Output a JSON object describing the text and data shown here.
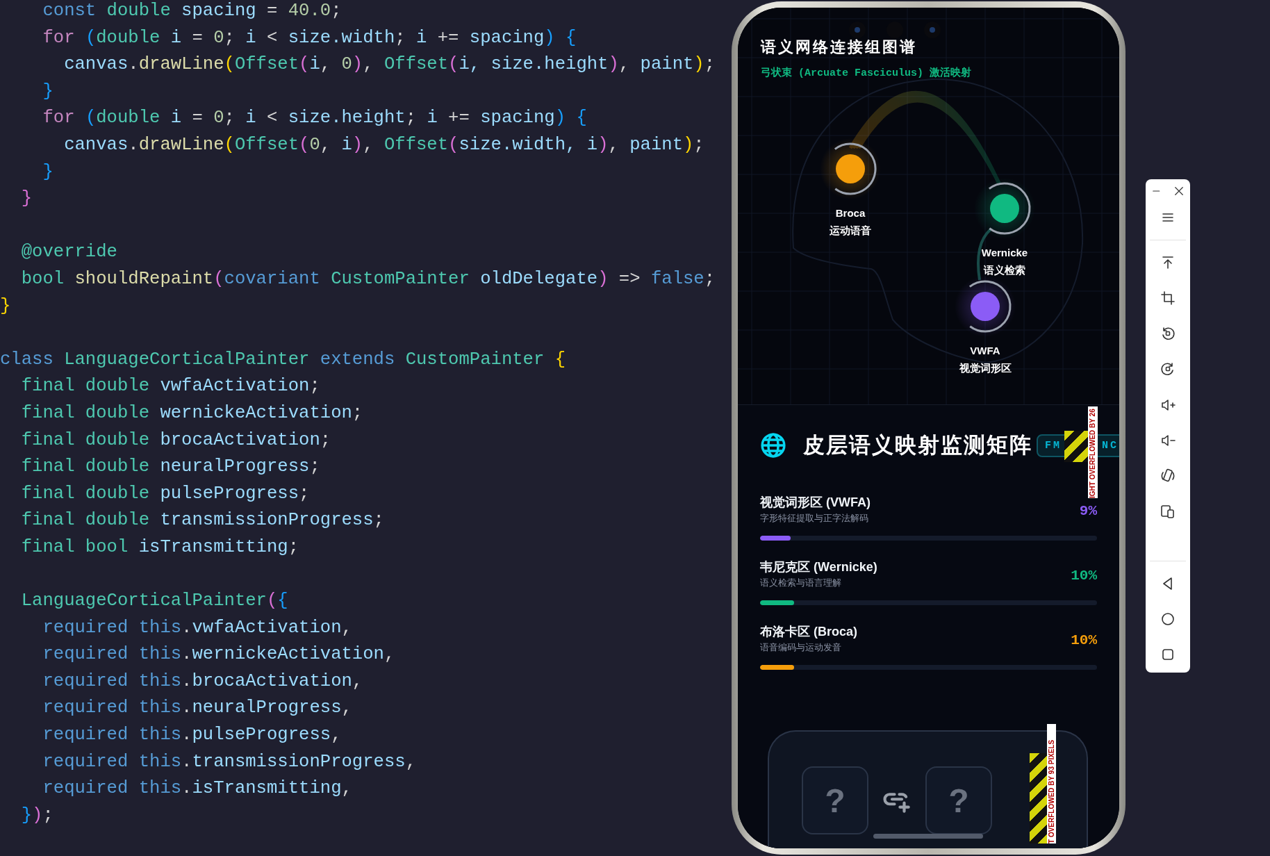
{
  "code_editor": {
    "lines": [
      {
        "kind": "code",
        "tokens": [
          {
            "text": "    const",
            "kind": "keyword"
          },
          {
            "text": " double",
            "kind": "type"
          },
          {
            "text": " spacing",
            "kind": "variable"
          },
          {
            "text": " = ",
            "kind": "punct"
          },
          {
            "text": "40.0",
            "kind": "number"
          },
          {
            "text": ";",
            "kind": "punct"
          }
        ]
      },
      {
        "kind": "code",
        "tokens": [
          {
            "text": "    for ",
            "kind": "control"
          },
          {
            "text": "(",
            "kind": "bracket3"
          },
          {
            "text": "double",
            "kind": "type"
          },
          {
            "text": " i",
            "kind": "variable"
          },
          {
            "text": " = ",
            "kind": "punct"
          },
          {
            "text": "0",
            "kind": "number"
          },
          {
            "text": "; ",
            "kind": "punct"
          },
          {
            "text": "i",
            "kind": "variable"
          },
          {
            "text": " < ",
            "kind": "punct"
          },
          {
            "text": "size.width",
            "kind": "variable"
          },
          {
            "text": "; ",
            "kind": "punct"
          },
          {
            "text": "i",
            "kind": "variable"
          },
          {
            "text": " += ",
            "kind": "punct"
          },
          {
            "text": "spacing",
            "kind": "variable"
          },
          {
            "text": ")",
            "kind": "bracket3"
          },
          {
            "text": " {",
            "kind": "bracket3"
          }
        ]
      },
      {
        "kind": "code",
        "tokens": [
          {
            "text": "      canvas",
            "kind": "variable"
          },
          {
            "text": ".",
            "kind": "punct"
          },
          {
            "text": "drawLine",
            "kind": "function"
          },
          {
            "text": "(",
            "kind": "bracket1"
          },
          {
            "text": "Offset",
            "kind": "type"
          },
          {
            "text": "(",
            "kind": "bracket2"
          },
          {
            "text": "i",
            "kind": "variable"
          },
          {
            "text": ", ",
            "kind": "punct"
          },
          {
            "text": "0",
            "kind": "number"
          },
          {
            "text": ")",
            "kind": "bracket2"
          },
          {
            "text": ", ",
            "kind": "punct"
          },
          {
            "text": "Offset",
            "kind": "type"
          },
          {
            "text": "(",
            "kind": "bracket2"
          },
          {
            "text": "i, size.height",
            "kind": "variable"
          },
          {
            "text": ")",
            "kind": "bracket2"
          },
          {
            "text": ", ",
            "kind": "punct"
          },
          {
            "text": "paint",
            "kind": "variable"
          },
          {
            "text": ")",
            "kind": "bracket1"
          },
          {
            "text": ";",
            "kind": "punct"
          }
        ]
      },
      {
        "kind": "code",
        "tokens": [
          {
            "text": "    }",
            "kind": "bracket3"
          }
        ]
      },
      {
        "kind": "code",
        "tokens": [
          {
            "text": "    for ",
            "kind": "control"
          },
          {
            "text": "(",
            "kind": "bracket3"
          },
          {
            "text": "double",
            "kind": "type"
          },
          {
            "text": " i",
            "kind": "variable"
          },
          {
            "text": " = ",
            "kind": "punct"
          },
          {
            "text": "0",
            "kind": "number"
          },
          {
            "text": "; ",
            "kind": "punct"
          },
          {
            "text": "i",
            "kind": "variable"
          },
          {
            "text": " < ",
            "kind": "punct"
          },
          {
            "text": "size.height",
            "kind": "variable"
          },
          {
            "text": "; ",
            "kind": "punct"
          },
          {
            "text": "i",
            "kind": "variable"
          },
          {
            "text": " += ",
            "kind": "punct"
          },
          {
            "text": "spacing",
            "kind": "variable"
          },
          {
            "text": ")",
            "kind": "bracket3"
          },
          {
            "text": " {",
            "kind": "bracket3"
          }
        ]
      },
      {
        "kind": "code",
        "tokens": [
          {
            "text": "      canvas",
            "kind": "variable"
          },
          {
            "text": ".",
            "kind": "punct"
          },
          {
            "text": "drawLine",
            "kind": "function"
          },
          {
            "text": "(",
            "kind": "bracket1"
          },
          {
            "text": "Offset",
            "kind": "type"
          },
          {
            "text": "(",
            "kind": "bracket2"
          },
          {
            "text": "0",
            "kind": "number"
          },
          {
            "text": ", ",
            "kind": "punct"
          },
          {
            "text": "i",
            "kind": "variable"
          },
          {
            "text": ")",
            "kind": "bracket2"
          },
          {
            "text": ", ",
            "kind": "punct"
          },
          {
            "text": "Offset",
            "kind": "type"
          },
          {
            "text": "(",
            "kind": "bracket2"
          },
          {
            "text": "size.width, i",
            "kind": "variable"
          },
          {
            "text": ")",
            "kind": "bracket2"
          },
          {
            "text": ", ",
            "kind": "punct"
          },
          {
            "text": "paint",
            "kind": "variable"
          },
          {
            "text": ")",
            "kind": "bracket1"
          },
          {
            "text": ";",
            "kind": "punct"
          }
        ]
      },
      {
        "kind": "code",
        "tokens": [
          {
            "text": "    }",
            "kind": "bracket3"
          }
        ]
      },
      {
        "kind": "code",
        "tokens": [
          {
            "text": "  }",
            "kind": "bracket2"
          }
        ]
      },
      {
        "kind": "blank"
      },
      {
        "kind": "code",
        "tokens": [
          {
            "text": "  @override",
            "kind": "type"
          }
        ]
      },
      {
        "kind": "code",
        "tokens": [
          {
            "text": "  bool ",
            "kind": "type"
          },
          {
            "text": "shouldRepaint",
            "kind": "function"
          },
          {
            "text": "(",
            "kind": "bracket2"
          },
          {
            "text": "covariant",
            "kind": "keyword"
          },
          {
            "text": " CustomPainter",
            "kind": "type"
          },
          {
            "text": " oldDelegate",
            "kind": "variable"
          },
          {
            "text": ")",
            "kind": "bracket2"
          },
          {
            "text": " => ",
            "kind": "punct"
          },
          {
            "text": "false",
            "kind": "keyword"
          },
          {
            "text": ";",
            "kind": "punct"
          }
        ]
      },
      {
        "kind": "code",
        "tokens": [
          {
            "text": "}",
            "kind": "bracket1"
          }
        ]
      },
      {
        "kind": "blank"
      },
      {
        "kind": "code",
        "tokens": [
          {
            "text": "class",
            "kind": "keyword"
          },
          {
            "text": " LanguageCorticalPainter",
            "kind": "type"
          },
          {
            "text": " extends",
            "kind": "keyword"
          },
          {
            "text": " CustomPainter",
            "kind": "type"
          },
          {
            "text": " {",
            "kind": "bracket1"
          }
        ]
      },
      {
        "kind": "code",
        "tokens": [
          {
            "text": "  final",
            "kind": "type"
          },
          {
            "text": " double",
            "kind": "type"
          },
          {
            "text": " vwfaActivation",
            "kind": "variable"
          },
          {
            "text": ";",
            "kind": "punct"
          }
        ]
      },
      {
        "kind": "code",
        "tokens": [
          {
            "text": "  final",
            "kind": "type"
          },
          {
            "text": " double",
            "kind": "type"
          },
          {
            "text": " wernickeActivation",
            "kind": "variable"
          },
          {
            "text": ";",
            "kind": "punct"
          }
        ]
      },
      {
        "kind": "code",
        "tokens": [
          {
            "text": "  final",
            "kind": "type"
          },
          {
            "text": " double",
            "kind": "type"
          },
          {
            "text": " brocaActivation",
            "kind": "variable"
          },
          {
            "text": ";",
            "kind": "punct"
          }
        ]
      },
      {
        "kind": "code",
        "tokens": [
          {
            "text": "  final",
            "kind": "type"
          },
          {
            "text": " double",
            "kind": "type"
          },
          {
            "text": " neuralProgress",
            "kind": "variable"
          },
          {
            "text": ";",
            "kind": "punct"
          }
        ]
      },
      {
        "kind": "code",
        "tokens": [
          {
            "text": "  final",
            "kind": "type"
          },
          {
            "text": " double",
            "kind": "type"
          },
          {
            "text": " pulseProgress",
            "kind": "variable"
          },
          {
            "text": ";",
            "kind": "punct"
          }
        ]
      },
      {
        "kind": "code",
        "tokens": [
          {
            "text": "  final",
            "kind": "type"
          },
          {
            "text": " double",
            "kind": "type"
          },
          {
            "text": " transmissionProgress",
            "kind": "variable"
          },
          {
            "text": ";",
            "kind": "punct"
          }
        ]
      },
      {
        "kind": "code",
        "tokens": [
          {
            "text": "  final",
            "kind": "type"
          },
          {
            "text": " bool",
            "kind": "type"
          },
          {
            "text": " isTransmitting",
            "kind": "variable"
          },
          {
            "text": ";",
            "kind": "punct"
          }
        ]
      },
      {
        "kind": "blank"
      },
      {
        "kind": "code",
        "tokens": [
          {
            "text": "  LanguageCorticalPainter",
            "kind": "type"
          },
          {
            "text": "(",
            "kind": "bracket2"
          },
          {
            "text": "{",
            "kind": "bracket3"
          }
        ]
      },
      {
        "kind": "code",
        "tokens": [
          {
            "text": "    required",
            "kind": "keyword"
          },
          {
            "text": " this",
            "kind": "keyword"
          },
          {
            "text": ".",
            "kind": "punct"
          },
          {
            "text": "vwfaActivation",
            "kind": "variable"
          },
          {
            "text": ",",
            "kind": "punct"
          }
        ]
      },
      {
        "kind": "code",
        "tokens": [
          {
            "text": "    required",
            "kind": "keyword"
          },
          {
            "text": " this",
            "kind": "keyword"
          },
          {
            "text": ".",
            "kind": "punct"
          },
          {
            "text": "wernickeActivation",
            "kind": "variable"
          },
          {
            "text": ",",
            "kind": "punct"
          }
        ]
      },
      {
        "kind": "code",
        "tokens": [
          {
            "text": "    required",
            "kind": "keyword"
          },
          {
            "text": " this",
            "kind": "keyword"
          },
          {
            "text": ".",
            "kind": "punct"
          },
          {
            "text": "brocaActivation",
            "kind": "variable"
          },
          {
            "text": ",",
            "kind": "punct"
          }
        ]
      },
      {
        "kind": "code",
        "tokens": [
          {
            "text": "    required",
            "kind": "keyword"
          },
          {
            "text": " this",
            "kind": "keyword"
          },
          {
            "text": ".",
            "kind": "punct"
          },
          {
            "text": "neuralProgress",
            "kind": "variable"
          },
          {
            "text": ",",
            "kind": "punct"
          }
        ]
      },
      {
        "kind": "code",
        "tokens": [
          {
            "text": "    required",
            "kind": "keyword"
          },
          {
            "text": " this",
            "kind": "keyword"
          },
          {
            "text": ".",
            "kind": "punct"
          },
          {
            "text": "pulseProgress",
            "kind": "variable"
          },
          {
            "text": ",",
            "kind": "punct"
          }
        ]
      },
      {
        "kind": "code",
        "tokens": [
          {
            "text": "    required",
            "kind": "keyword"
          },
          {
            "text": " this",
            "kind": "keyword"
          },
          {
            "text": ".",
            "kind": "punct"
          },
          {
            "text": "transmissionProgress",
            "kind": "variable"
          },
          {
            "text": ",",
            "kind": "punct"
          }
        ]
      },
      {
        "kind": "code",
        "tokens": [
          {
            "text": "    required",
            "kind": "keyword"
          },
          {
            "text": " this",
            "kind": "keyword"
          },
          {
            "text": ".",
            "kind": "punct"
          },
          {
            "text": "isTransmitting",
            "kind": "variable"
          },
          {
            "text": ",",
            "kind": "punct"
          }
        ]
      },
      {
        "kind": "code",
        "tokens": [
          {
            "text": "  }",
            "kind": "bracket3"
          },
          {
            "text": ")",
            "kind": "bracket2"
          },
          {
            "text": ";",
            "kind": "punct"
          }
        ]
      }
    ]
  },
  "device": {
    "graph": {
      "title": "语义网络连接组图谱",
      "subtitle": "弓状束 (Arcuate Fasciculus) 激活映射",
      "nodes": [
        {
          "name": "Broca",
          "label": "运动语音",
          "color": "#f59e0b"
        },
        {
          "name": "Wernicke",
          "label": "语义检索",
          "color": "#10b981"
        },
        {
          "name": "VWFA",
          "label": "视觉词形区",
          "color": "#8b5cf6"
        }
      ]
    },
    "monitor": {
      "title": "皮层语义映射监测矩阵",
      "badge": [
        "FM",
        "NC"
      ],
      "overflow_warning": "IGHT OVERFLOWED BY 26",
      "regions": [
        {
          "name": "视觉词形区 (VWFA)",
          "description": "字形特征提取与正字法解码",
          "reading": "9%",
          "level": 0.09,
          "color": "#8b5cf6"
        },
        {
          "name": "韦尼克区 (Wernicke)",
          "description": "语义检索与语言理解",
          "reading": "10%",
          "level": 0.1,
          "color": "#10b981"
        },
        {
          "name": "布洛卡区 (Broca)",
          "description": "语音编码与运动发音",
          "reading": "10%",
          "level": 0.1,
          "color": "#f59e0b"
        }
      ]
    },
    "bottom_card": {
      "slots": [
        "?",
        "?"
      ],
      "overflow_warning": "T OVERFLOWED BY 93 PIXELS"
    }
  }
}
